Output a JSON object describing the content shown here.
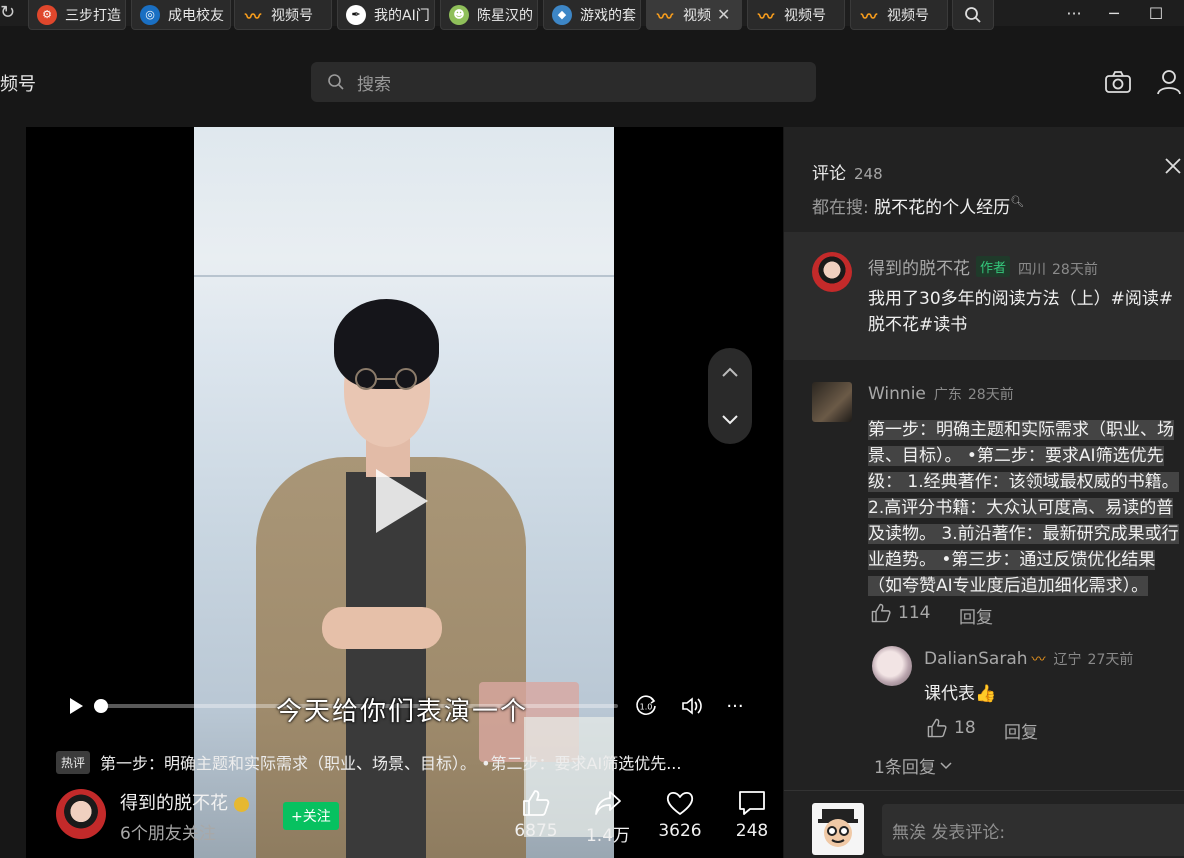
{
  "tabs": [
    {
      "label": "三步打造",
      "icon": "red-app-icon",
      "color": "#e0472c"
    },
    {
      "label": "成电校友",
      "icon": "uestc-icon",
      "color": "#1a6fc2"
    },
    {
      "label": "视频号",
      "icon": "channels-icon",
      "color": "#f49b1d"
    },
    {
      "label": "我的AI门",
      "icon": "quill-icon",
      "color": "#111111"
    },
    {
      "label": "陈星汉的",
      "icon": "game-icon",
      "color": "#8fbf5a"
    },
    {
      "label": "游戏的套",
      "icon": "game-icon-2",
      "color": "#3d86c6"
    },
    {
      "label": "视频",
      "icon": "channels-icon",
      "color": "#f49b1d"
    },
    {
      "label": "视频号",
      "icon": "channels-icon",
      "color": "#f49b1d"
    },
    {
      "label": "视频号",
      "icon": "channels-icon",
      "color": "#f49b1d"
    }
  ],
  "window": {
    "more": "···",
    "minimize": "─",
    "maximize": "☐"
  },
  "header": {
    "app_title": "频号",
    "search_placeholder": "搜索"
  },
  "video": {
    "subtitle": "今天给你们表演一个",
    "hot_badge": "热评",
    "description": "第一步：明确主题和实际需求（职业、场景、目标）。 •第二步：要求AI筛选优先...",
    "progress": 0.0,
    "author": {
      "name": "得到的脱不花",
      "friends": "6个朋友关注",
      "follow": "+关注"
    },
    "stats": {
      "likes": "6875",
      "shares": "1.4万",
      "favorites": "3626",
      "comments": "248"
    }
  },
  "comments_panel": {
    "title": "评论",
    "count": "248",
    "search_prefix": "都在搜:",
    "search_keyword": "脱不花的个人经历",
    "pinned": {
      "name": "得到的脱不花",
      "tag": "作者",
      "location": "四川",
      "time": "28天前",
      "text_line1": "我用了30多年的阅读方法（上）#阅读#",
      "text_line2": "脱不花#读书"
    },
    "comment": {
      "name": "Winnie",
      "location": "广东",
      "time": "28天前",
      "lines": [
        "第一步：明确主题和实际需求（职业、场",
        "景、目标）。 •第二步：要求AI筛选优先",
        "级： 1.经典著作：该领域最权威的书籍。",
        "2.高评分书籍：大众认可度高、易读的普",
        "及读物。 3.前沿著作：最新研究成果或行",
        "业趋势。 •第三步：通过反馈优化结果",
        "（如夸赞AI专业度后追加细化需求）。"
      ],
      "likes": "114",
      "reply": "回复"
    },
    "reply": {
      "name": "DalianSarah",
      "location": "辽宁",
      "time": "27天前",
      "text": "课代表👍",
      "likes": "18",
      "reply": "回复"
    },
    "more_replies": "1条回复",
    "input_placeholder": "無涘 发表评论:"
  }
}
